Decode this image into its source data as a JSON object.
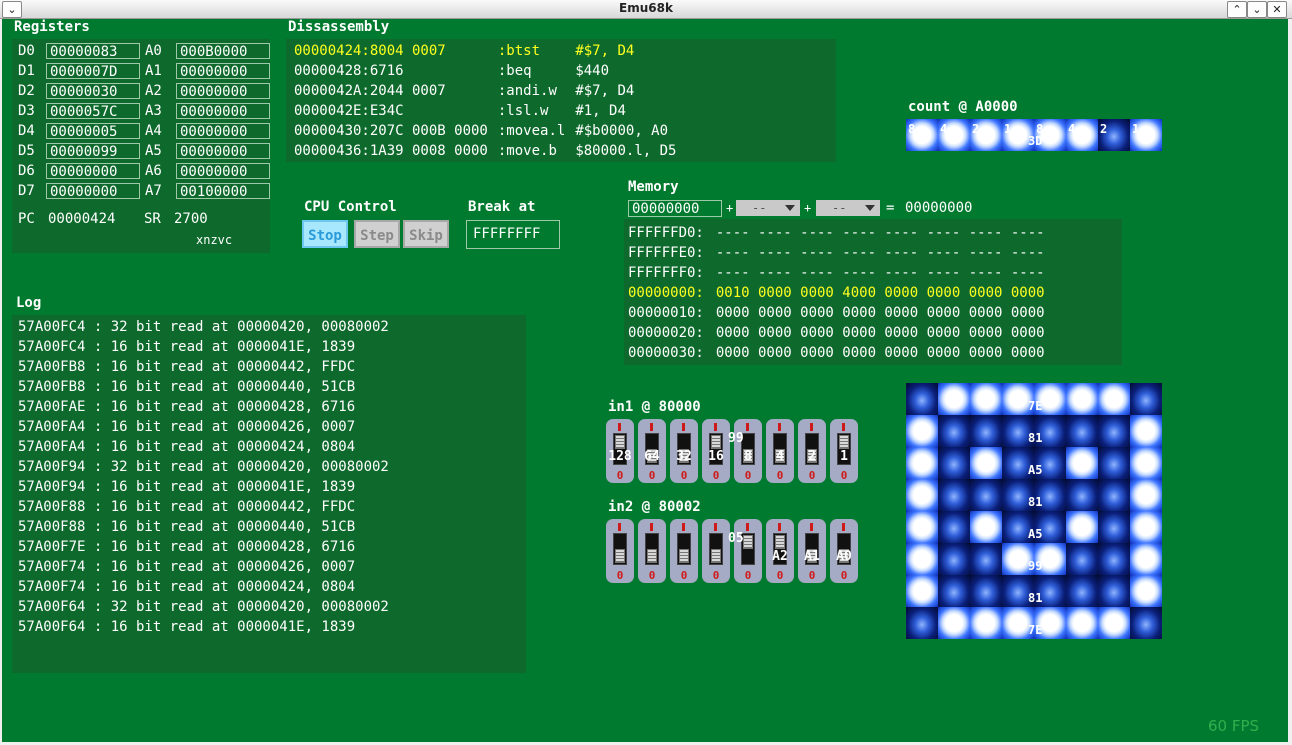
{
  "window": {
    "title": "Emu68k",
    "fps": "60 FPS"
  },
  "registers": {
    "label": "Registers",
    "rows": [
      {
        "d": "D0",
        "dv": "00000083",
        "a": "A0",
        "av": "000B0000"
      },
      {
        "d": "D1",
        "dv": "0000007D",
        "a": "A1",
        "av": "00000000"
      },
      {
        "d": "D2",
        "dv": "00000030",
        "a": "A2",
        "av": "00000000"
      },
      {
        "d": "D3",
        "dv": "0000057C",
        "a": "A3",
        "av": "00000000"
      },
      {
        "d": "D4",
        "dv": "00000005",
        "a": "A4",
        "av": "00000000"
      },
      {
        "d": "D5",
        "dv": "00000099",
        "a": "A5",
        "av": "00000000"
      },
      {
        "d": "D6",
        "dv": "00000000",
        "a": "A6",
        "av": "00000000"
      },
      {
        "d": "D7",
        "dv": "00000000",
        "a": "A7",
        "av": "00100000"
      }
    ],
    "pc_label": "PC",
    "pc": "00000424",
    "sr_label": "SR",
    "sr": "2700",
    "flags": "xnzvc"
  },
  "disassembly": {
    "label": "Dissassembly",
    "rows": [
      {
        "addr": "00000424:8004 0007     ",
        "mn": ":btst   ",
        "op": "#$7, D4",
        "current": true
      },
      {
        "addr": "00000428:6716          ",
        "mn": ":beq    ",
        "op": "$440"
      },
      {
        "addr": "0000042A:2044 0007     ",
        "mn": ":andi.w ",
        "op": "#$7, D4"
      },
      {
        "addr": "0000042E:E34C          ",
        "mn": ":lsl.w  ",
        "op": "#1, D4"
      },
      {
        "addr": "00000430:207C 000B 0000",
        "mn": ":movea.l",
        "op": "#$b0000, A0"
      },
      {
        "addr": "00000436:1A39 0008 0000",
        "mn": ":move.b ",
        "op": "$80000.l, D5"
      }
    ]
  },
  "cpu": {
    "label": "CPU Control",
    "stop": "Stop",
    "step": "Step",
    "skip": "Skip",
    "break_label": "Break at",
    "break_value": "FFFFFFFF"
  },
  "count": {
    "label": "count @ A0000",
    "leds": [
      "on",
      "on",
      "on",
      "on",
      "on",
      "on",
      "off",
      "on"
    ],
    "labels": [
      "8",
      "4",
      "2",
      "1",
      "8",
      "4",
      "2",
      "1"
    ],
    "overlay": "3D"
  },
  "memory": {
    "label": "Memory",
    "base": "00000000",
    "plus1": "+",
    "dd1": "--",
    "plus2": "+",
    "dd2": "--",
    "eq": "=",
    "result": "00000000",
    "rows": [
      {
        "addr": "FFFFFFD0:",
        "data": "---- ---- ---- ---- ---- ---- ---- ----"
      },
      {
        "addr": "FFFFFFE0:",
        "data": "---- ---- ---- ---- ---- ---- ---- ----"
      },
      {
        "addr": "FFFFFFF0:",
        "data": "---- ---- ---- ---- ---- ---- ---- ----"
      },
      {
        "addr": "00000000:",
        "data": "0010 0000 0000 4000 0000 0000 0000 0000",
        "current": true
      },
      {
        "addr": "00000010:",
        "data": "0000 0000 0000 0000 0000 0000 0000 0000"
      },
      {
        "addr": "00000020:",
        "data": "0000 0000 0000 0000 0000 0000 0000 0000"
      },
      {
        "addr": "00000030:",
        "data": "0000 0000 0000 0000 0000 0000 0000 0000"
      }
    ]
  },
  "log": {
    "label": "Log",
    "lines": [
      "57A00FC4 : 32 bit read at 00000420, 00080002",
      "57A00FC4 : 16 bit read at 0000041E, 1839",
      "57A00FB8 : 16 bit read at 00000442, FFDC",
      "57A00FB8 : 16 bit read at 00000440, 51CB",
      "57A00FAE : 16 bit read at 00000428, 6716",
      "57A00FA4 : 16 bit read at 00000426, 0007",
      "57A00FA4 : 16 bit read at 00000424, 0804",
      "57A00F94 : 32 bit read at 00000420, 00080002",
      "57A00F94 : 16 bit read at 0000041E, 1839",
      "57A00F88 : 16 bit read at 00000442, FFDC",
      "57A00F88 : 16 bit read at 00000440, 51CB",
      "57A00F7E : 16 bit read at 00000428, 6716",
      "57A00F74 : 16 bit read at 00000426, 0007",
      "57A00F74 : 16 bit read at 00000424, 0804",
      "57A00F64 : 32 bit read at 00000420, 00080002",
      "57A00F64 : 16 bit read at 0000041E, 1839"
    ]
  },
  "in1": {
    "label": "in1 @ 80000",
    "caps": [
      "128",
      "64",
      "32",
      "16",
      "8",
      "4",
      "2",
      "1"
    ],
    "up": [
      true,
      false,
      false,
      true,
      false,
      false,
      false,
      true
    ],
    "overlay": "99"
  },
  "in2": {
    "label": "in2 @ 80002",
    "caps": [
      "",
      "",
      "",
      "",
      "",
      "A2",
      "A1",
      "A0"
    ],
    "up": [
      false,
      false,
      false,
      false,
      true,
      true,
      false,
      false
    ],
    "overlay": "05"
  },
  "matrix": {
    "rows": [
      {
        "leds": [
          0,
          1,
          1,
          1,
          1,
          1,
          1,
          0
        ],
        "label": "7E"
      },
      {
        "leds": [
          1,
          0,
          0,
          0,
          0,
          0,
          0,
          1
        ],
        "label": "81"
      },
      {
        "leds": [
          1,
          0,
          1,
          0,
          0,
          1,
          0,
          1
        ],
        "label": "A5"
      },
      {
        "leds": [
          1,
          0,
          0,
          0,
          0,
          0,
          0,
          1
        ],
        "label": "81"
      },
      {
        "leds": [
          1,
          0,
          1,
          0,
          0,
          1,
          0,
          1
        ],
        "label": "A5"
      },
      {
        "leds": [
          1,
          0,
          0,
          1,
          1,
          0,
          0,
          1
        ],
        "label": "99"
      },
      {
        "leds": [
          1,
          0,
          0,
          0,
          0,
          0,
          0,
          1
        ],
        "label": "81"
      },
      {
        "leds": [
          0,
          1,
          1,
          1,
          1,
          1,
          1,
          0
        ],
        "label": "7E"
      }
    ]
  }
}
